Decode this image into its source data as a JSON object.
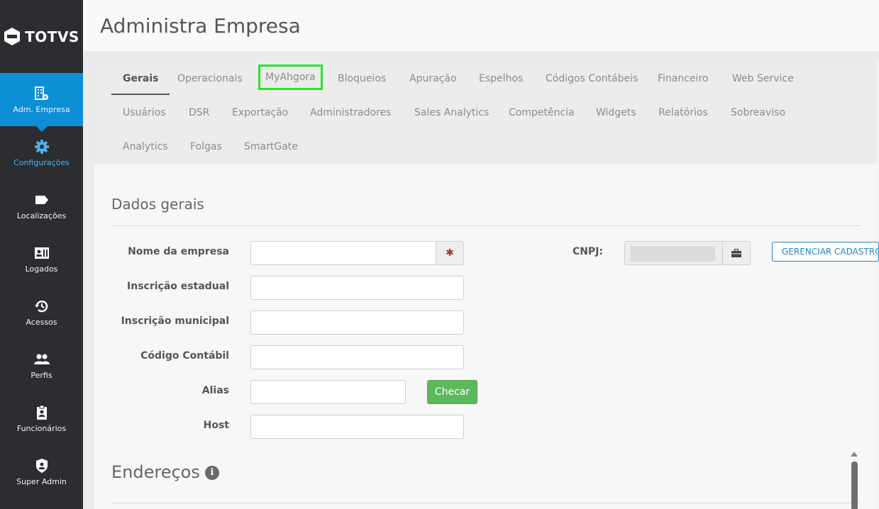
{
  "brand": {
    "name": "TOTVS"
  },
  "sidebar": {
    "items": [
      {
        "label": "Adm. Empresa",
        "icon": "building-gear-icon"
      },
      {
        "label": "Configurações",
        "icon": "gear-icon"
      },
      {
        "label": "Localizações",
        "icon": "tag-icon"
      },
      {
        "label": "Logados",
        "icon": "id-card-icon"
      },
      {
        "label": "Acessos",
        "icon": "history-icon"
      },
      {
        "label": "Perfis",
        "icon": "users-icon"
      },
      {
        "label": "Funcionários",
        "icon": "clipboard-user-icon"
      },
      {
        "label": "Super Admin",
        "icon": "shield-user-icon"
      }
    ]
  },
  "header": {
    "title": "Administra Empresa"
  },
  "tabs": [
    "Gerais",
    "Operacionais",
    "MyAhgora",
    "Bloqueios",
    "Apuração",
    "Espelhos",
    "Códigos Contábeis",
    "Financeiro",
    "Web Service",
    "Usuários",
    "DSR",
    "Exportação",
    "Administradores",
    "Sales Analytics",
    "Competência",
    "Widgets",
    "Relatórios",
    "Sobreaviso",
    "Analytics",
    "Folgas",
    "SmartGate"
  ],
  "active_tab": "Gerais",
  "dados_gerais": {
    "title": "Dados gerais",
    "labels": {
      "nome": "Nome da empresa",
      "inscricao_estadual": "Inscrição estadual",
      "inscricao_municipal": "Inscrição municipal",
      "codigo_contabil": "Código Contábil",
      "alias": "Alias",
      "host": "Host",
      "cnpj": "CNPJ:"
    },
    "required_marker": "✱",
    "checar_label": "Checar",
    "gerenciar_label": "GERENCIAR CADASTRO"
  },
  "enderecos": {
    "title": "Endereços"
  },
  "colors": {
    "accent": "#0d8fd6",
    "highlight": "#2ee02e",
    "success": "#5cb85c",
    "sidebar": "#2b2d31"
  }
}
